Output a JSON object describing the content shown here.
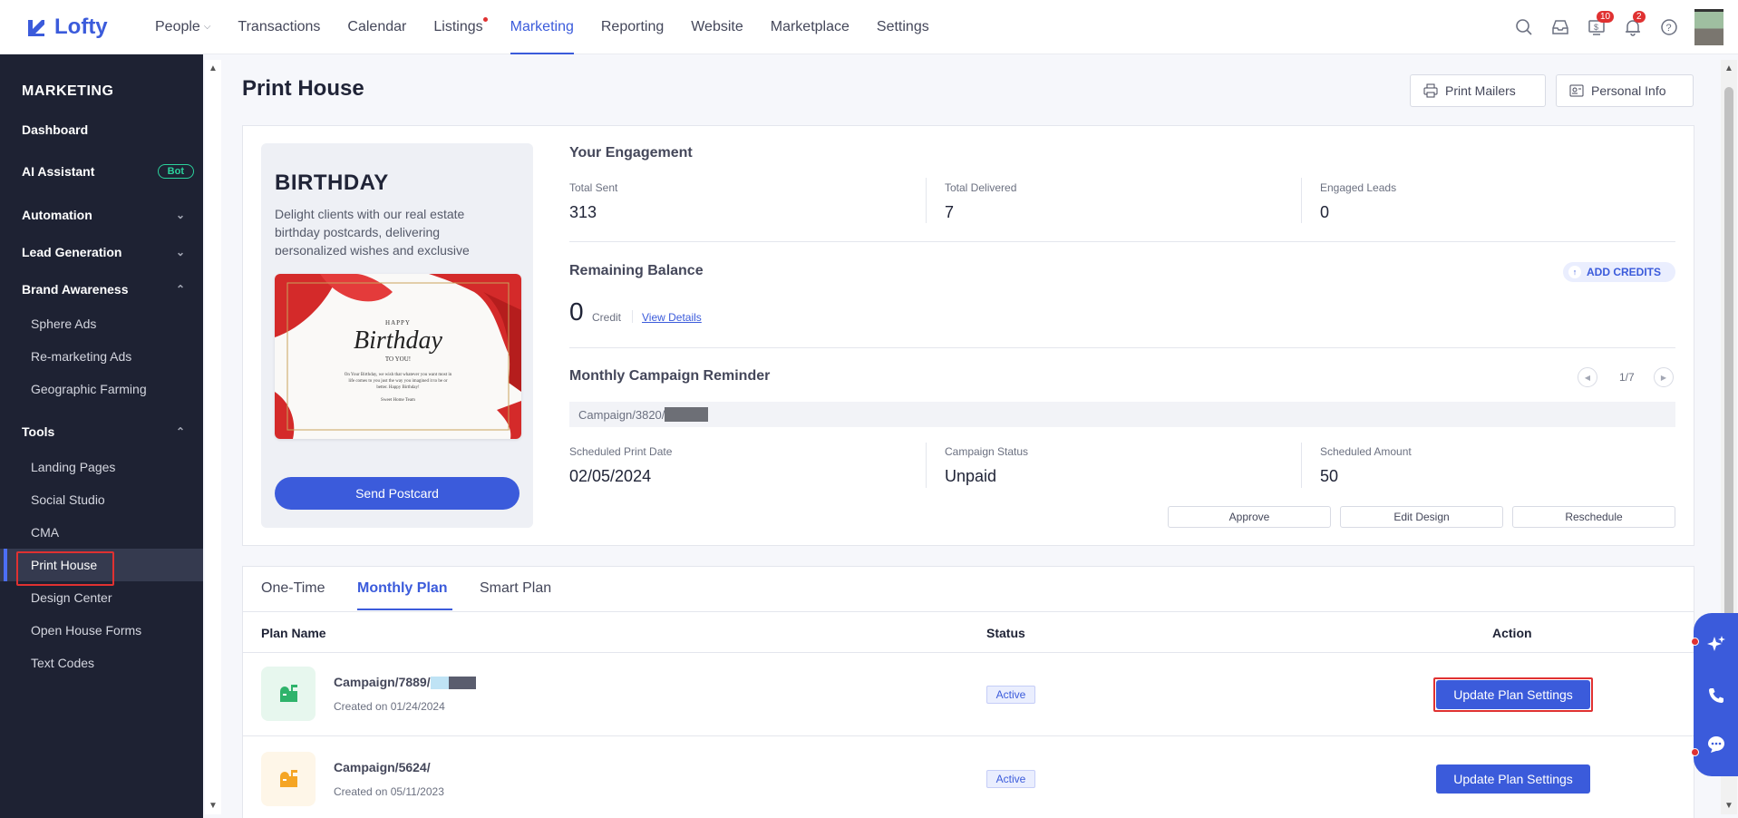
{
  "app": {
    "logo": "Lofty"
  },
  "nav": {
    "items": [
      {
        "label": "People",
        "caret": true
      },
      {
        "label": "Transactions"
      },
      {
        "label": "Calendar"
      },
      {
        "label": "Listings",
        "dot": true
      },
      {
        "label": "Marketing",
        "active": true
      },
      {
        "label": "Reporting"
      },
      {
        "label": "Website"
      },
      {
        "label": "Marketplace"
      },
      {
        "label": "Settings"
      }
    ],
    "badges": {
      "billing": "10",
      "notifications": "2"
    }
  },
  "sidebar": {
    "title": "MARKETING",
    "dashboard": "Dashboard",
    "ai_assistant": "AI Assistant",
    "ai_badge": "Bot",
    "automation": "Automation",
    "lead_generation": "Lead Generation",
    "brand_awareness": "Brand Awareness",
    "brand_items": [
      "Sphere Ads",
      "Re-marketing Ads",
      "Geographic Farming"
    ],
    "tools": "Tools",
    "tool_items": [
      "Landing Pages",
      "Social Studio",
      "CMA",
      "Print House",
      "Design Center",
      "Open House Forms",
      "Text Codes"
    ],
    "active_item": "Print House"
  },
  "page": {
    "title": "Print House",
    "print_mailers": "Print Mailers",
    "personal_info": "Personal Info"
  },
  "promo": {
    "title": "BIRTHDAY",
    "description": "Delight clients with our real estate birthday postcards, delivering personalized wishes and exclusive",
    "postcard": {
      "happy": "HAPPY",
      "birthday": "Birthday",
      "to_you": "TO YOU!",
      "message": "On Your Birthday, we wish that whatever you want most in life comes to you just the way you imagined it to be or better. Happy Birthday!",
      "sign": "Sweet Home Team"
    },
    "send_button": "Send Postcard"
  },
  "engagement": {
    "title": "Your Engagement",
    "total_sent_label": "Total Sent",
    "total_sent": "313",
    "total_delivered_label": "Total Delivered",
    "total_delivered": "7",
    "engaged_leads_label": "Engaged Leads",
    "engaged_leads": "0"
  },
  "balance": {
    "title": "Remaining Balance",
    "value": "0",
    "unit": "Credit",
    "view_details": "View Details",
    "add_credits": "ADD CREDITS"
  },
  "reminder": {
    "title": "Monthly Campaign Reminder",
    "pager": "1/7",
    "campaign": "Campaign/3820/",
    "scheduled_print_date_label": "Scheduled Print Date",
    "scheduled_print_date": "02/05/2024",
    "campaign_status_label": "Campaign Status",
    "campaign_status": "Unpaid",
    "scheduled_amount_label": "Scheduled Amount",
    "scheduled_amount": "50",
    "approve": "Approve",
    "edit_design": "Edit Design",
    "reschedule": "Reschedule"
  },
  "plans": {
    "tabs": [
      "One-Time",
      "Monthly Plan",
      "Smart Plan"
    ],
    "active_tab": "Monthly Plan",
    "col_plan_name": "Plan Name",
    "col_status": "Status",
    "col_action": "Action",
    "rows": [
      {
        "name": "Campaign/7889/",
        "created": "Created on 01/24/2024",
        "status": "Active",
        "action": "Update Plan Settings"
      },
      {
        "name": "Campaign/5624/",
        "created": "Created on 05/11/2023",
        "status": "Active",
        "action": "Update Plan Settings"
      }
    ]
  },
  "colors": {
    "primary": "#3b5bdb",
    "sidebar": "#1e2233",
    "highlight": "#e03131"
  }
}
